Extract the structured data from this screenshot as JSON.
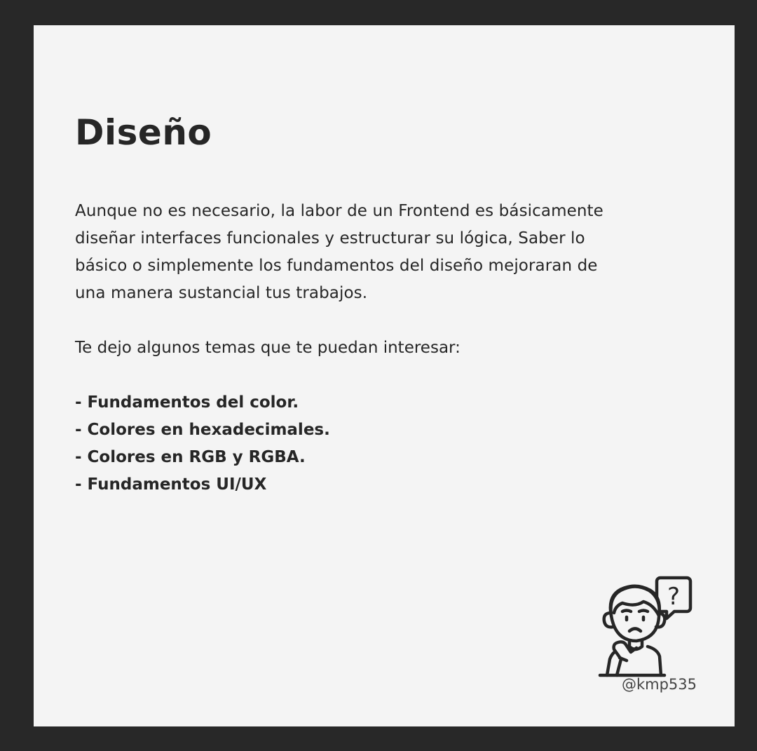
{
  "title": "Diseño",
  "paragraph": [
    "Aunque no es necesario, la labor de un Frontend es básicamente",
    "diseñar interfaces funcionales y estructurar su lógica, Saber lo",
    "básico o simplemente los fundamentos del diseño mejoraran de",
    "una manera sustancial tus trabajos."
  ],
  "intro": "Te dejo algunos temas que te puedan interesar:",
  "topics": [
    "- Fundamentos del color.",
    "- Colores en hexadecimales.",
    "- Colores en RGB y RGBA.",
    "- Fundamentos UI/UX"
  ],
  "illustration": {
    "icon": "confused-person-question-icon",
    "bubble_text": "?"
  },
  "handle": "@kmp535",
  "colors": {
    "frame": "#282828",
    "card": "#f4f4f4",
    "text": "#262626"
  }
}
